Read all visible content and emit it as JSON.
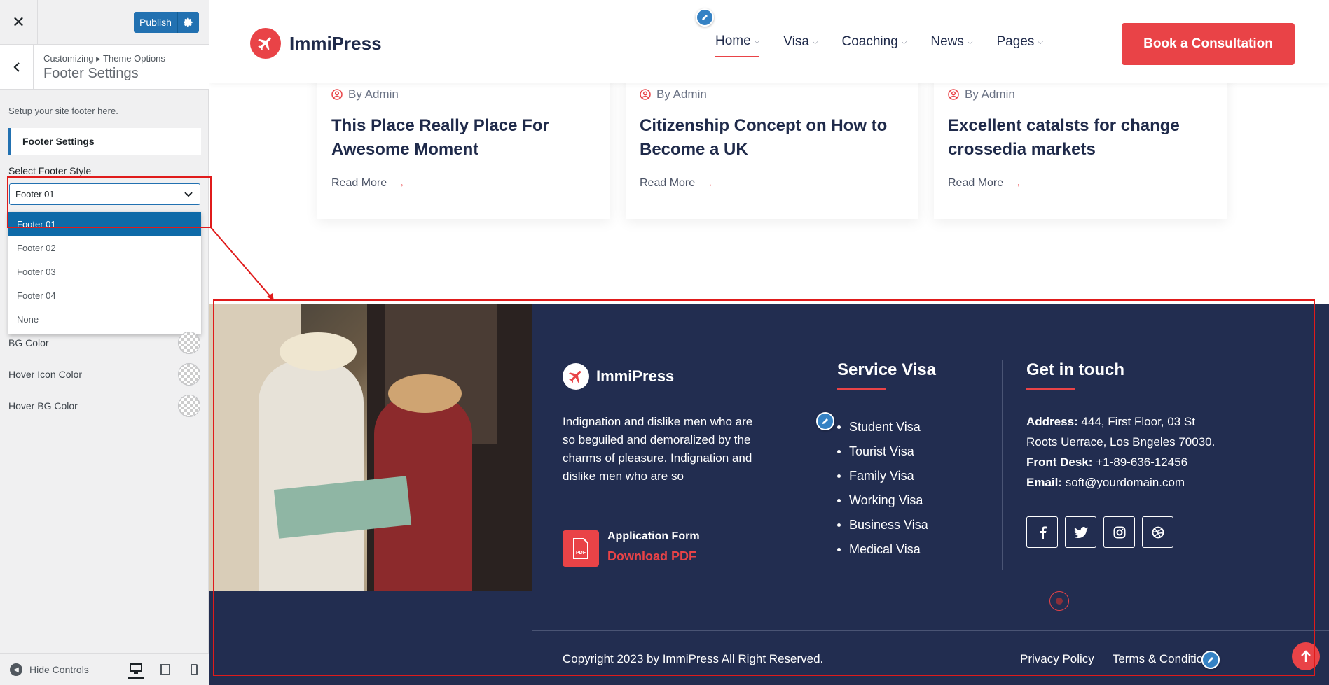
{
  "panel": {
    "close_glyph": "✕",
    "publish_label": "Publish",
    "breadcrumb": "Customizing ▸ Theme Options",
    "section_title": "Footer Settings",
    "description": "Setup your site footer here.",
    "group_label": "Footer Settings",
    "select_label": "Select Footer Style",
    "select_value": "Footer 01",
    "options": [
      "Footer 01",
      "Footer 02",
      "Footer 03",
      "Footer 04",
      "None"
    ],
    "props": [
      "BG Color",
      "Hover Icon Color",
      "Hover BG Color"
    ],
    "hide_controls": "Hide Controls"
  },
  "site": {
    "brand": "ImmiPress",
    "nav": [
      "Home",
      "Visa",
      "Coaching",
      "News",
      "Pages"
    ],
    "cta": "Book a Consultation"
  },
  "posts": [
    {
      "by": "By Admin",
      "title": "This Place Really Place For Awesome Moment",
      "more": "Read More"
    },
    {
      "by": "By Admin",
      "title": "Citizenship Concept on How to Become a UK",
      "more": "Read More"
    },
    {
      "by": "By Admin",
      "title": "Excellent catalsts for change crossedia markets",
      "more": "Read More"
    }
  ],
  "footer": {
    "brand": "ImmiPress",
    "about": "Indignation and dislike men who are so beguiled and demoralized by the charms of pleasure. Indignation and dislike men who are so",
    "application_form": "Application Form",
    "download_pdf": "Download PDF",
    "service_heading": "Service Visa",
    "services": [
      "Student Visa",
      "Tourist Visa",
      "Family Visa",
      "Working Visa",
      "Business Visa",
      "Medical Visa"
    ],
    "contact_heading": "Get in touch",
    "address_label": "Address:",
    "address_line1": "444, First Floor, 03 St",
    "address_line2": "Roots Uerrace, Los Bngeles 70030.",
    "desk_label": "Front Desk:",
    "desk_value": "+1-89-636-12456",
    "email_label": "Email:",
    "email_value": "soft@yourdomain.com",
    "copyright": "Copyright 2023 by ImmiPress All Right Reserved.",
    "links": [
      "Privacy Policy",
      "Terms & Conditions"
    ]
  },
  "colors": {
    "accent": "#e94347",
    "navy": "#222d50",
    "wp_blue": "#2271b1"
  }
}
